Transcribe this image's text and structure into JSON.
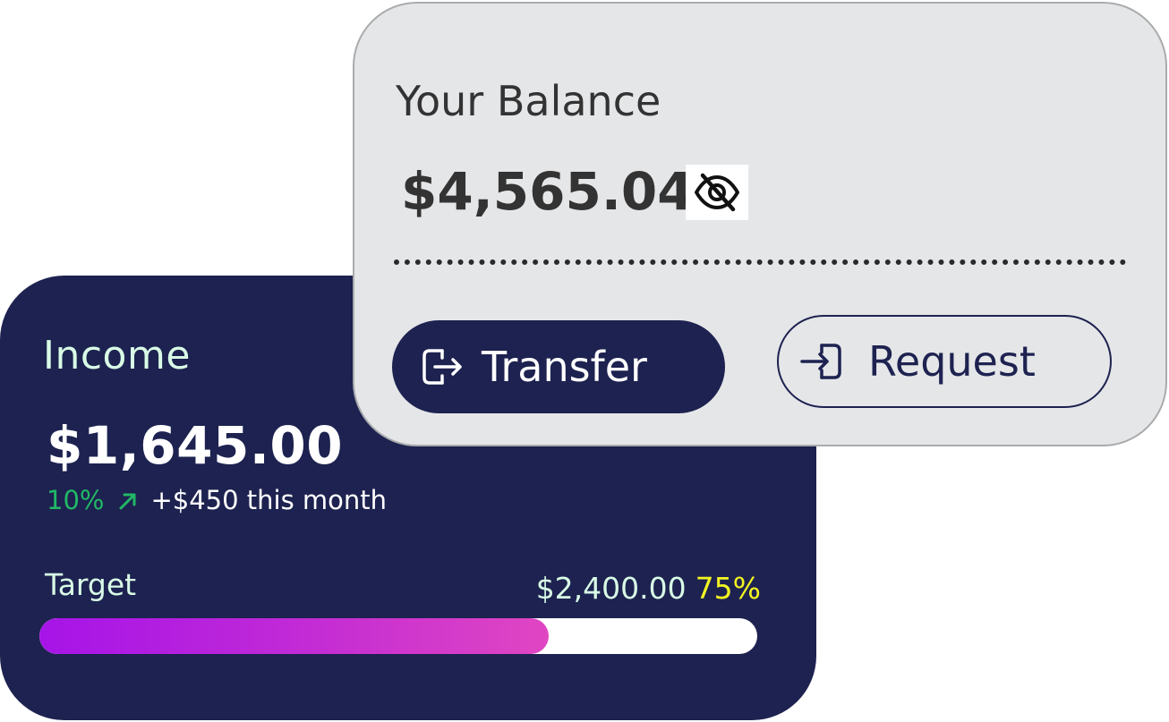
{
  "income": {
    "title": "Income",
    "amount": "$1,645.00",
    "change_percent": "10%",
    "change_text": "+$450 this month",
    "target_label": "Target",
    "target_amount": "$2,400.00",
    "target_percent": "75%",
    "progress": 0.71,
    "colors": {
      "card": "#1d2250",
      "positive": "#22b866",
      "highlight": "#f3f521"
    }
  },
  "balance": {
    "title": "Your Balance",
    "amount": "$4,565.04",
    "visibility_icon": "eye-off-icon",
    "transfer_label": "Transfer",
    "transfer_icon": "transfer-out-icon",
    "request_label": "Request",
    "request_icon": "request-in-icon"
  }
}
